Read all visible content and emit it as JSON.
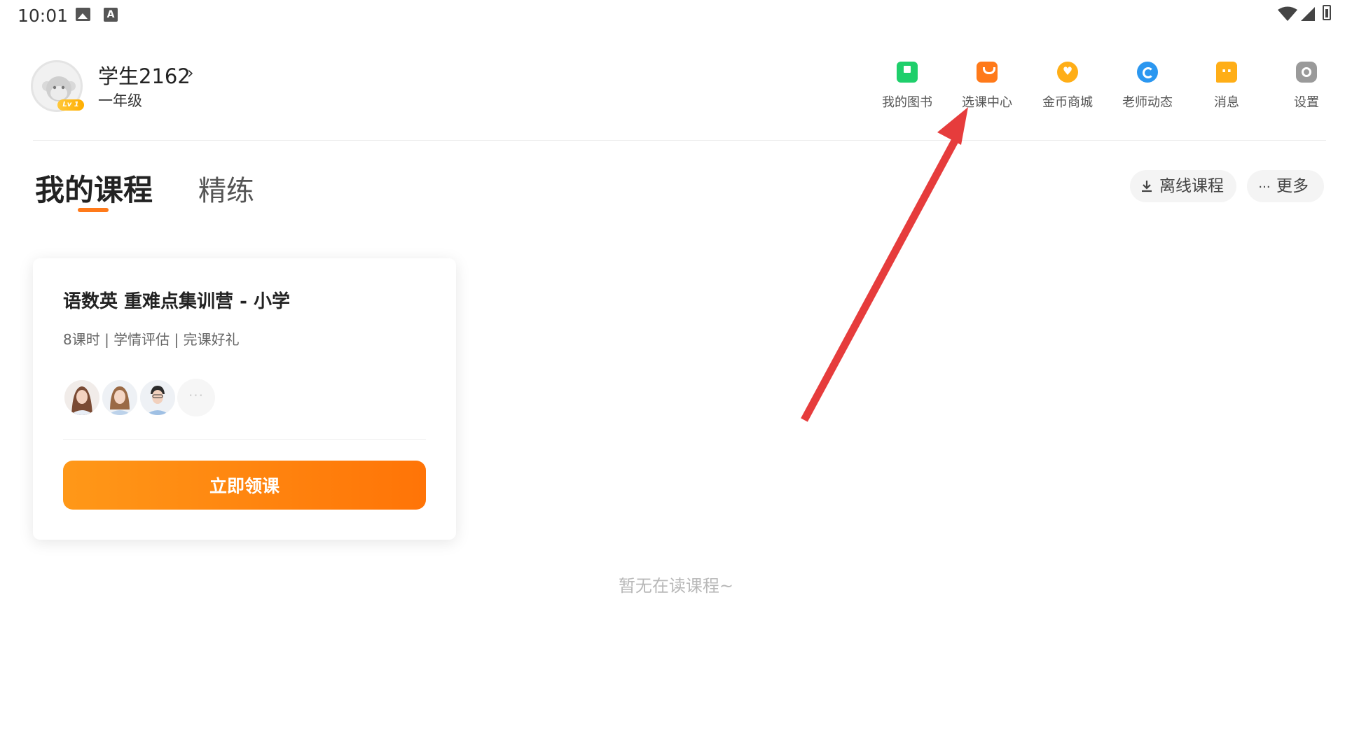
{
  "status_bar": {
    "time": "10:01"
  },
  "profile": {
    "username": "学生2162",
    "chevron": "›",
    "grade": "一年级",
    "level_badge": "Lv 1"
  },
  "nav": [
    {
      "label": "我的图书",
      "icon": "book-icon",
      "color": "#1fcf6b"
    },
    {
      "label": "选课中心",
      "icon": "shopping-bag-icon",
      "color": "#ff7a1a"
    },
    {
      "label": "金币商城",
      "icon": "coin-store-icon",
      "color": "#ffae17"
    },
    {
      "label": "老师动态",
      "icon": "teacher-feed-icon",
      "color": "#2b97f0"
    },
    {
      "label": "消息",
      "icon": "message-icon",
      "color": "#ffae17"
    },
    {
      "label": "设置",
      "icon": "settings-icon",
      "color": "#9a9a9a"
    }
  ],
  "tabs": {
    "active": "我的课程",
    "inactive": "精练"
  },
  "actions": {
    "offline": "离线课程",
    "more": "更多"
  },
  "course_card": {
    "title": "语数英 重难点集训营 - 小学",
    "subtitle": "8课时 | 学情评估 | 完课好礼",
    "more_teachers": "···",
    "cta": "立即领课"
  },
  "empty_state": "暂无在读课程~",
  "accent_color": "#ff7a1a",
  "annotation_arrow_color": "#e63c3c"
}
